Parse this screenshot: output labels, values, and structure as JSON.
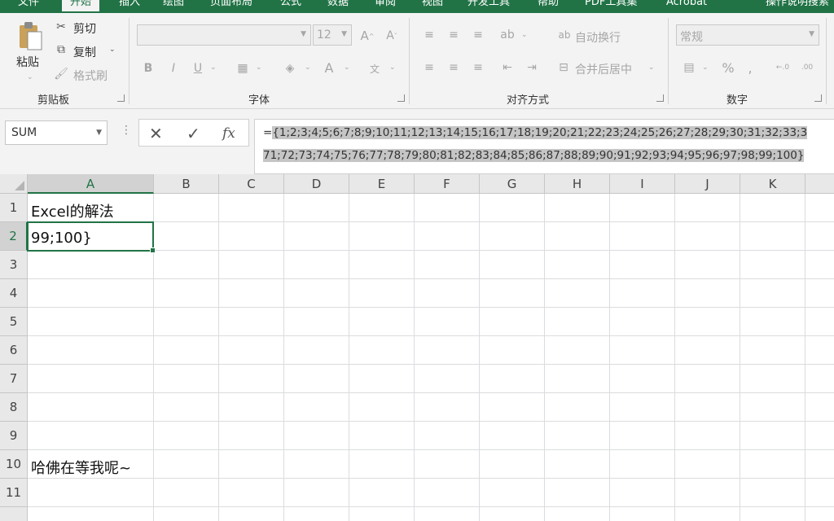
{
  "tabs": [
    "文件",
    "开始",
    "插入",
    "绘图",
    "页面布局",
    "公式",
    "数据",
    "审阅",
    "视图",
    "开发工具",
    "帮助",
    "PDF工具集",
    "Acrobat",
    "操作说明搜索"
  ],
  "clipboard": {
    "paste": "粘贴",
    "cut": "剪切",
    "copy": "复制",
    "format_painter": "格式刷",
    "group": "剪贴板"
  },
  "font": {
    "size": "12",
    "group": "字体"
  },
  "alignment": {
    "wrap": "自动换行",
    "merge": "合并后居中",
    "group": "对齐方式"
  },
  "number": {
    "format": "常规",
    "group": "数字"
  },
  "formula_bar": {
    "name_box": "SUM",
    "fx": "fx",
    "line1": "={1;2;3;4;5;6;7;8;9;10;11;12;13;14;15;16;17;18;19;20;21;22;23;24;25;26;27;28;29;30;31;32;33;3",
    "line2": "71;72;73;74;75;76;77;78;79;80;81;82;83;84;85;86;87;88;89;90;91;92;93;94;95;96;97;98;99;100}"
  },
  "columns": [
    "A",
    "B",
    "C",
    "D",
    "E",
    "F",
    "G",
    "H",
    "I",
    "J",
    "K"
  ],
  "rows": [
    "1",
    "2",
    "3",
    "4",
    "5",
    "6",
    "7",
    "8",
    "9",
    "10",
    "11"
  ],
  "cells": {
    "A1": "Excel的解法",
    "A2": "99;100}",
    "A10": "哈佛在等我呢~"
  },
  "icons": [
    "paste-icon",
    "scissors-icon",
    "copy-icon",
    "format-painter-icon",
    "check-icon",
    "cancel-icon",
    "fx-icon"
  ]
}
